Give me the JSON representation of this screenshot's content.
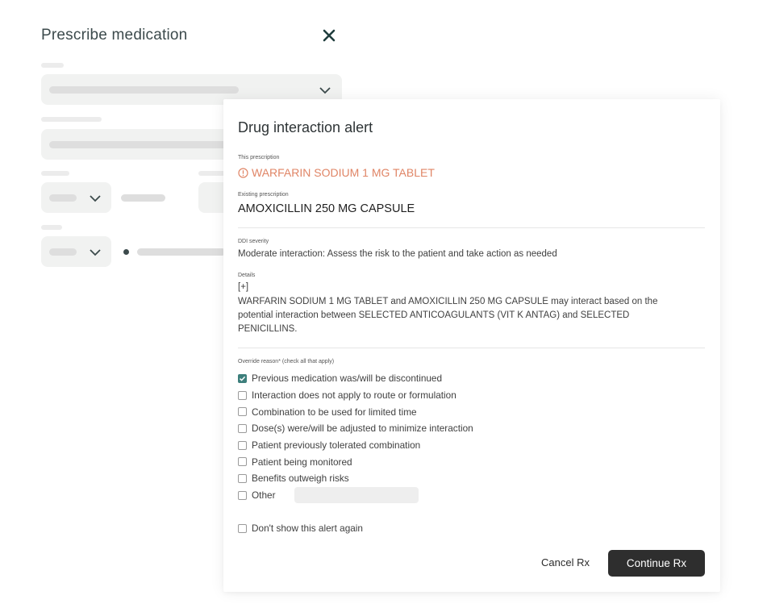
{
  "background": {
    "title": "Prescribe medication",
    "close_icon": "close-icon"
  },
  "modal": {
    "title": "Drug interaction alert",
    "this_prescription_label": "This prescription",
    "this_prescription_value": "WARFARIN SODIUM 1 MG TABLET",
    "existing_prescription_label": "Existing prescription",
    "existing_prescription_value": "AMOXICILLIN 250 MG CAPSULE",
    "severity_label": "DDI severity",
    "severity_value": "Moderate interaction: Assess the risk to the patient and take action as needed",
    "details_label": "Details",
    "details_toggle": "[+]",
    "details_line1": "WARFARIN SODIUM 1 MG TABLET and AMOXICILLIN 250 MG CAPSULE may interact based on the",
    "details_line2": "potential interaction between SELECTED ANTICOAGULANTS (VIT K ANTAG) and SELECTED",
    "details_line3": "PENICILLINS.",
    "override_label": "Override reason* (check all that apply)",
    "reasons": [
      {
        "label": "Previous medication was/will be  discontinued",
        "checked": true
      },
      {
        "label": "Interaction does not apply to route or formulation",
        "checked": false
      },
      {
        "label": "Combination to be used for limited time",
        "checked": false
      },
      {
        "label": "Dose(s) were/will be adjusted to minimize interaction",
        "checked": false
      },
      {
        "label": "Patient previously tolerated combination",
        "checked": false
      },
      {
        "label": "Patient being monitored",
        "checked": false
      },
      {
        "label": "Benefits outweigh risks",
        "checked": false
      },
      {
        "label": "Other",
        "checked": false
      }
    ],
    "other_input_value": "",
    "dont_show_label": "Don't show this alert again",
    "cancel_label": "Cancel Rx",
    "continue_label": "Continue Rx"
  },
  "colors": {
    "warning": "#e08566",
    "checked": "#3d7f7c",
    "primary_button": "#2e2e2e"
  }
}
